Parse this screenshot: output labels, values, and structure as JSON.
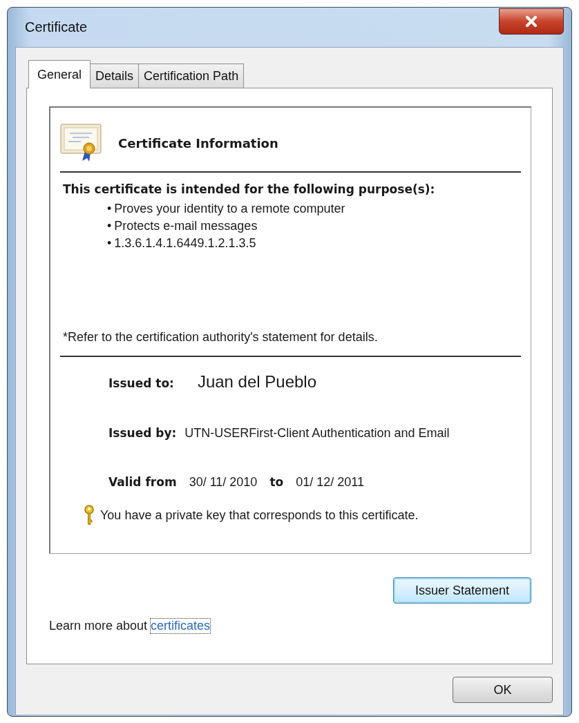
{
  "window": {
    "title": "Certificate"
  },
  "tabs": [
    {
      "label": "General",
      "selected": true
    },
    {
      "label": "Details",
      "selected": false
    },
    {
      "label": "Certification Path",
      "selected": false
    }
  ],
  "certificate_information": {
    "heading": "Certificate Information",
    "purpose_heading": "This certificate is intended for the following purpose(s):",
    "purposes": [
      {
        "bullet": "•",
        "text": "Proves your identity to a remote computer"
      },
      {
        "bullet": "•",
        "text": "Protects e-mail messages"
      },
      {
        "bullet": "•",
        "text": "1.3.6.1.4.1.6449.1.2.1.3.5"
      }
    ],
    "note": "*Refer to the certification authority's statement for details.",
    "issued_to": {
      "label": "Issued to:",
      "value": "Juan del Pueblo"
    },
    "issued_by": {
      "label": "Issued by:",
      "value": "UTN-USERFirst-Client Authentication and Email"
    },
    "validity": {
      "label": "Valid from",
      "from": "30/ 11/ 2010",
      "to_label": "to",
      "to": "01/ 12/ 2011"
    },
    "private_key_note": "You have a private key that corresponds to this certificate."
  },
  "issuer_statement_button": {
    "label": "Issuer Statement",
    "focused": true
  },
  "learn_more": {
    "text": "Learn more about",
    "link": "certificates"
  },
  "ok_button": {
    "label": "OK"
  }
}
